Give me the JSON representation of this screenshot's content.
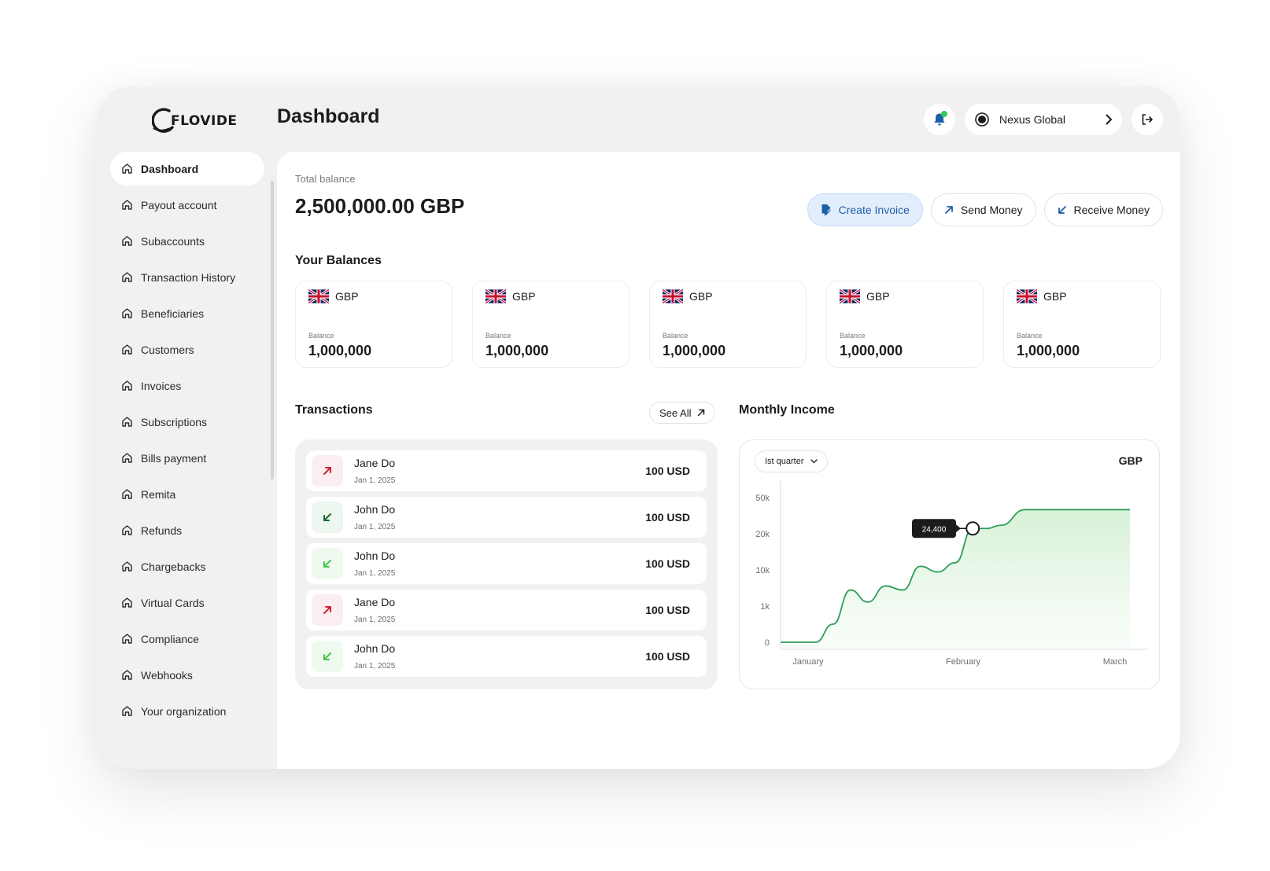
{
  "brand": {
    "logo_text": "FLOVIDE"
  },
  "header": {
    "title": "Dashboard",
    "org_name": "Nexus Global"
  },
  "sidebar": {
    "items": [
      {
        "label": "Dashboard",
        "active": true
      },
      {
        "label": "Payout account"
      },
      {
        "label": "Subaccounts"
      },
      {
        "label": "Transaction History"
      },
      {
        "label": "Beneficiaries"
      },
      {
        "label": "Customers"
      },
      {
        "label": "Invoices"
      },
      {
        "label": "Subscriptions"
      },
      {
        "label": "Bills payment"
      },
      {
        "label": "Remita"
      },
      {
        "label": "Refunds"
      },
      {
        "label": "Chargebacks"
      },
      {
        "label": "Virtual Cards"
      },
      {
        "label": "Compliance"
      },
      {
        "label": "Webhooks"
      },
      {
        "label": "Your organization"
      }
    ]
  },
  "summary": {
    "total_label": "Total balance",
    "total_value": "2,500,000.00 GBP"
  },
  "actions": {
    "create_invoice": "Create Invoice",
    "send_money": "Send Money",
    "receive_money": "Receive Money"
  },
  "balances": {
    "title": "Your Balances",
    "cards": [
      {
        "currency": "GBP",
        "label": "Balance",
        "value": "1,000,000"
      },
      {
        "currency": "GBP",
        "label": "Balance",
        "value": "1,000,000"
      },
      {
        "currency": "GBP",
        "label": "Balance",
        "value": "1,000,000"
      },
      {
        "currency": "GBP",
        "label": "Balance",
        "value": "1,000,000"
      },
      {
        "currency": "GBP",
        "label": "Balance",
        "value": "1,000,000"
      }
    ]
  },
  "transactions": {
    "title": "Transactions",
    "see_all": "See All",
    "rows": [
      {
        "name": "Jane Do",
        "date": "Jan 1, 2025",
        "amount": "100 USD",
        "direction": "out"
      },
      {
        "name": "John Do",
        "date": "Jan 1, 2025",
        "amount": "100 USD",
        "direction": "in-dark"
      },
      {
        "name": "John Do",
        "date": "Jan 1, 2025",
        "amount": "100 USD",
        "direction": "in"
      },
      {
        "name": "Jane Do",
        "date": "Jan 1, 2025",
        "amount": "100 USD",
        "direction": "out"
      },
      {
        "name": "John Do",
        "date": "Jan 1, 2025",
        "amount": "100 USD",
        "direction": "in"
      }
    ]
  },
  "income": {
    "title": "Monthly Income",
    "period": "Ist quarter",
    "currency": "GBP"
  },
  "colors": {
    "accent_blue": "#1f5fa8",
    "out_red": "#d0223a",
    "in_green": "#1e8a3a",
    "line_green": "#2e9c5a"
  },
  "chart_data": {
    "type": "area",
    "xlabel": "",
    "ylabel": "",
    "x_ticks": [
      "January",
      "February",
      "March"
    ],
    "y_ticks": [
      "0",
      "1k",
      "10k",
      "20k",
      "50k"
    ],
    "y_scale": "non-linear",
    "grid": false,
    "series": [
      {
        "points_x": [
          0.0,
          0.1,
          0.15,
          0.2,
          0.25,
          0.3,
          0.35,
          0.4,
          0.45,
          0.5,
          0.55,
          0.59,
          0.63,
          0.7,
          0.78,
          0.85,
          1.0
        ],
        "points_y": [
          0,
          0,
          500,
          5000,
          2000,
          6000,
          5000,
          11000,
          9500,
          12000,
          24400,
          24400,
          27000,
          40000,
          40000,
          40000,
          40000
        ]
      }
    ],
    "highlight": {
      "label": "24,400",
      "y": 24400
    }
  }
}
